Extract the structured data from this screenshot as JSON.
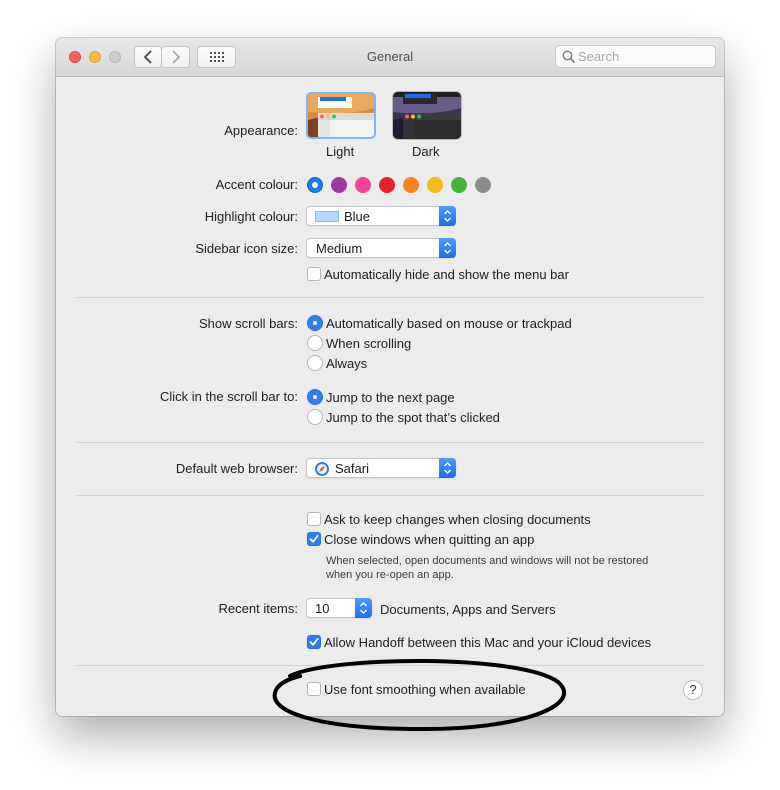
{
  "window": {
    "title": "General",
    "search_placeholder": "Search",
    "traffic_colors": {
      "close": "#fc605c",
      "minimize": "#fdbc40",
      "zoom": "#cdcdcd"
    }
  },
  "appearance": {
    "label": "Appearance:",
    "options": [
      {
        "name": "Light",
        "selected": true
      },
      {
        "name": "Dark",
        "selected": false
      }
    ]
  },
  "accent": {
    "label": "Accent colour:",
    "colors": [
      "#1a7cf5",
      "#9a3ca0",
      "#f0459b",
      "#e5202e",
      "#f6821f",
      "#f7b917",
      "#43b434",
      "#8c8c8c"
    ],
    "selected_index": 0
  },
  "highlight": {
    "label": "Highlight colour:",
    "value": "Blue",
    "swatch_color": "#b3d7ff"
  },
  "sidebar_icon": {
    "label": "Sidebar icon size:",
    "value": "Medium"
  },
  "menubar": {
    "label": "Automatically hide and show the menu bar",
    "checked": false
  },
  "scroll_bars": {
    "label": "Show scroll bars:",
    "options": [
      {
        "text": "Automatically based on mouse or trackpad",
        "selected": true
      },
      {
        "text": "When scrolling",
        "selected": false
      },
      {
        "text": "Always",
        "selected": false
      }
    ]
  },
  "click_scroll": {
    "label": "Click in the scroll bar to:",
    "options": [
      {
        "text": "Jump to the next page",
        "selected": true
      },
      {
        "text": "Jump to the spot that’s clicked",
        "selected": false
      }
    ]
  },
  "browser": {
    "label": "Default web browser:",
    "value": "Safari"
  },
  "ask_changes": {
    "label": "Ask to keep changes when closing documents",
    "checked": false
  },
  "close_windows": {
    "label": "Close windows when quitting an app",
    "checked": true,
    "note_line1": "When selected, open documents and windows will not be restored",
    "note_line2": "when you re-open an app."
  },
  "recent_items": {
    "label": "Recent items:",
    "value": "10",
    "suffix": "Documents, Apps and Servers"
  },
  "handoff": {
    "label": "Allow Handoff between this Mac and your iCloud devices",
    "checked": true
  },
  "font_smoothing": {
    "label": "Use font smoothing when available",
    "checked": false
  },
  "help": {
    "glyph": "?"
  }
}
